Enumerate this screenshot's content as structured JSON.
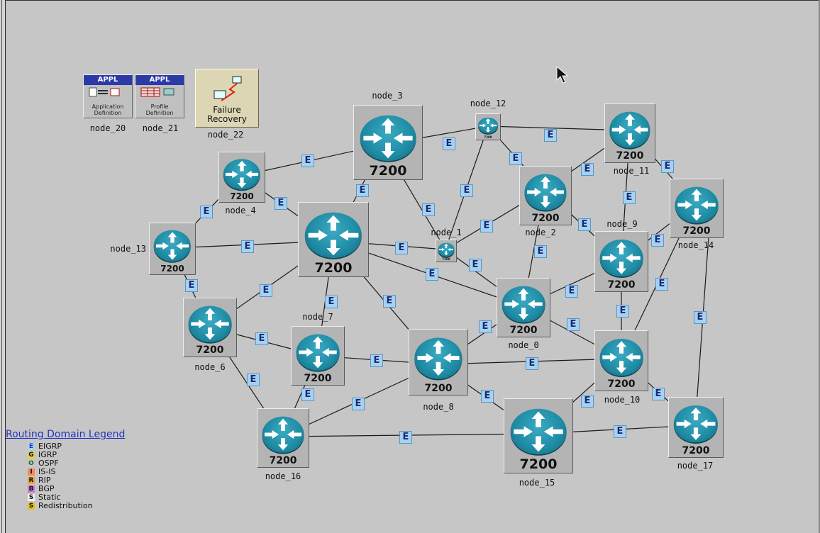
{
  "network": {
    "link_badge": "E",
    "router_model": "7200",
    "nodes": {
      "node_0": "node_0",
      "node_1": "node_1",
      "node_2": "node_2",
      "node_3": "node_3",
      "node_4": "node_4",
      "node_6": "node_6",
      "node_7": "node_7",
      "node_8": "node_8",
      "node_9": "node_9",
      "node_10": "node_10",
      "node_11": "node_11",
      "node_12": "node_12",
      "node_13": "node_13",
      "node_14": "node_14",
      "node_15": "node_15",
      "node_16": "node_16",
      "node_17": "node_17",
      "node_20": "node_20",
      "node_21": "node_21",
      "node_22": "node_22"
    }
  },
  "config_objects": {
    "application": {
      "header": "APPL",
      "caption_line1": "Application",
      "caption_line2": "Definition"
    },
    "profile": {
      "header": "APPL",
      "caption_line1": "Profile",
      "caption_line2": "Definition"
    },
    "failure": {
      "caption_line1": "Failure",
      "caption_line2": "Recovery"
    }
  },
  "legend": {
    "title": "Routing Domain Legend",
    "items": [
      {
        "key": "E",
        "label": "EIGRP",
        "color": "#2233bb",
        "bg": "#a6d2f2"
      },
      {
        "key": "G",
        "label": "IGRP",
        "color": "#111111",
        "bg": "#e0d24a"
      },
      {
        "key": "O",
        "label": "OSPF",
        "color": "#1d6b1d",
        "bg": "#c6c6c6"
      },
      {
        "key": "I",
        "label": "IS-IS",
        "color": "#111111",
        "bg": "#f28b5a"
      },
      {
        "key": "R",
        "label": "RIP",
        "color": "#111111",
        "bg": "#e9a640"
      },
      {
        "key": "B",
        "label": "BGP",
        "color": "#111111",
        "bg": "#d07ad0"
      },
      {
        "key": "S",
        "label": "Static",
        "color": "#111111",
        "bg": "#f0f0f0"
      },
      {
        "key": "S",
        "label": "Redistribution",
        "color": "#111111",
        "bg": "#e6c21a"
      }
    ]
  },
  "colors": {
    "canvas": "#c6c6c6",
    "router_teal": "#1e8ba4",
    "link_badge_bg": "#a6d2f2",
    "link_badge_text": "#1b2a78"
  }
}
